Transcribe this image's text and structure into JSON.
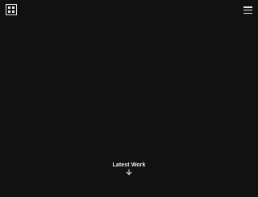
{
  "header": {
    "logo_icon": "four-squares-logo-icon",
    "menu_icon": "hamburger-menu-icon"
  },
  "hero": {
    "cta_label": "Latest Work",
    "cta_icon": "arrow-down-icon"
  },
  "colors": {
    "background": "#111111",
    "foreground": "#e6e6e6"
  }
}
